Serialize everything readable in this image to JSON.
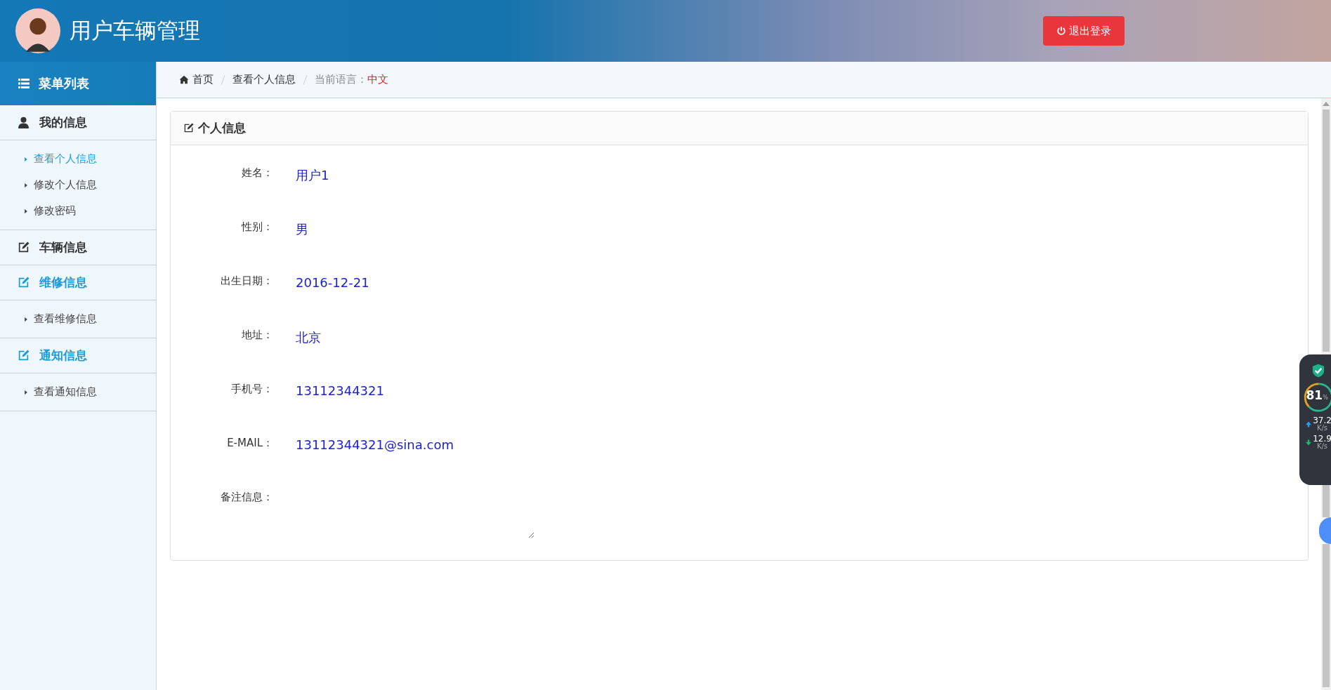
{
  "header": {
    "title": "用户车辆管理",
    "logout_button": "退出登录"
  },
  "sidebar": {
    "title": "菜单列表",
    "groups": [
      {
        "label": "我的信息",
        "kind": "user",
        "highlighted": false,
        "children": [
          {
            "label": "查看个人信息",
            "selected": true
          },
          {
            "label": "修改个人信息",
            "selected": false
          },
          {
            "label": "修改密码",
            "selected": false
          }
        ]
      },
      {
        "label": "车辆信息",
        "kind": "edit",
        "highlighted": false
      },
      {
        "label": "维修信息",
        "kind": "edit",
        "highlighted": true,
        "children": [
          {
            "label": "查看维修信息",
            "selected": false
          }
        ]
      },
      {
        "label": "通知信息",
        "kind": "edit",
        "highlighted": true,
        "children": [
          {
            "label": "查看通知信息",
            "selected": false
          }
        ]
      }
    ]
  },
  "breadcrumb": {
    "items": [
      "首页",
      "查看个人信息"
    ],
    "language_label": "当前语言：",
    "language": "中文"
  },
  "card": {
    "title": "个人信息",
    "fields": [
      {
        "label": "姓名：",
        "value": "用户1",
        "kind": "text"
      },
      {
        "label": "性别：",
        "value": "男",
        "kind": "text"
      },
      {
        "label": "出生日期：",
        "value": "2016-12-21",
        "kind": "text"
      },
      {
        "label": "地址：",
        "value": "北京",
        "kind": "text"
      },
      {
        "label": "手机号：",
        "value": "13112344321",
        "kind": "text"
      },
      {
        "label": "E-MAIL：",
        "value": "13112344321@sina.com",
        "kind": "text"
      },
      {
        "label": "备注信息：",
        "kind": "textarea"
      }
    ]
  },
  "monitor_widget": {
    "reading": "81",
    "unit": "%",
    "upload": "37.2",
    "upload_unit": "K/s",
    "download": "12.9",
    "download_unit": "K/s"
  }
}
